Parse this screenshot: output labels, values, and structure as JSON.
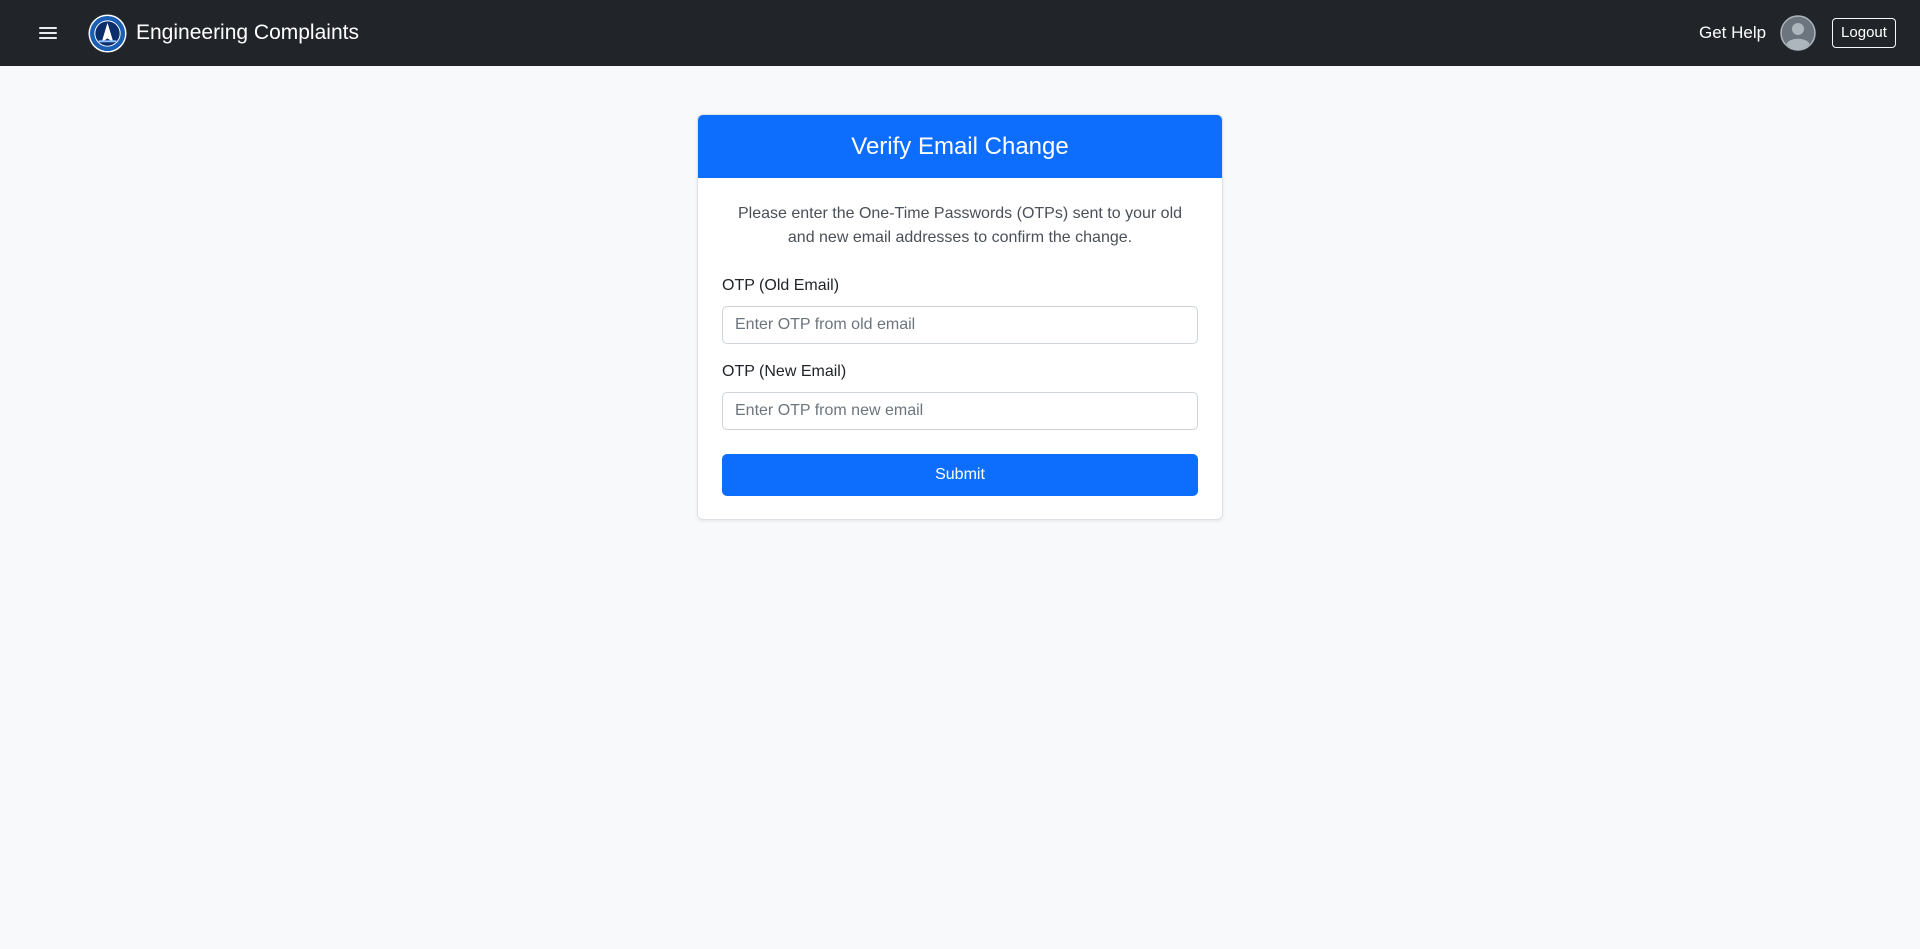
{
  "navbar": {
    "menu_icon": "hamburger-menu-icon",
    "logo_icon": "institution-seal-logo",
    "brand": "Engineering Complaints",
    "get_help": "Get Help",
    "avatar_icon": "user-avatar-icon",
    "logout": "Logout"
  },
  "card": {
    "title": "Verify Email Change",
    "description": "Please enter the One-Time Passwords (OTPs) sent to your old and new email addresses to confirm the change.",
    "old_otp": {
      "label": "OTP (Old Email)",
      "placeholder": "Enter OTP from old email",
      "value": ""
    },
    "new_otp": {
      "label": "OTP (New Email)",
      "placeholder": "Enter OTP from new email",
      "value": ""
    },
    "submit": "Submit"
  },
  "colors": {
    "navbar_bg": "#212529",
    "page_bg": "#f8f9fa",
    "primary": "#0d6efd"
  }
}
